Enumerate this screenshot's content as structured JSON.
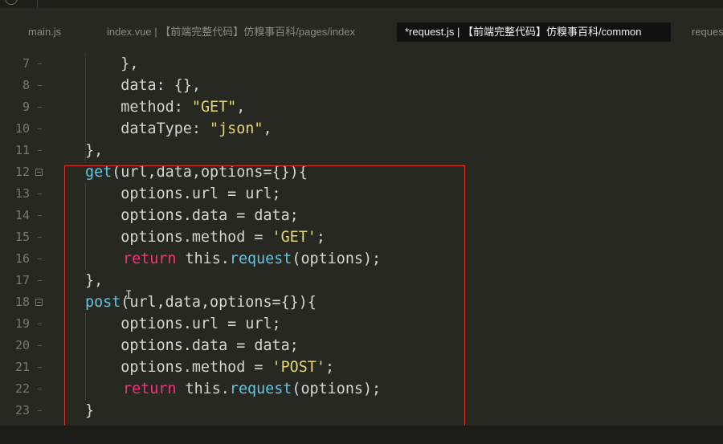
{
  "tabs": [
    {
      "label": "main.js",
      "active": false
    },
    {
      "label": "index.vue | 【前端完整代码】仿糗事百科/pages/index",
      "active": false
    },
    {
      "label": "*request.js | 【前端完整代码】仿糗事百科/common",
      "active": true
    },
    {
      "label": "reques",
      "active": false
    }
  ],
  "editor": {
    "lines": [
      {
        "num": "7",
        "fold": false
      },
      {
        "num": "8",
        "fold": false
      },
      {
        "num": "9",
        "fold": false
      },
      {
        "num": "10",
        "fold": false
      },
      {
        "num": "11",
        "fold": false
      },
      {
        "num": "12",
        "fold": true
      },
      {
        "num": "13",
        "fold": false
      },
      {
        "num": "14",
        "fold": false
      },
      {
        "num": "15",
        "fold": false
      },
      {
        "num": "16",
        "fold": false
      },
      {
        "num": "17",
        "fold": false
      },
      {
        "num": "18",
        "fold": true
      },
      {
        "num": "19",
        "fold": false
      },
      {
        "num": "20",
        "fold": false
      },
      {
        "num": "21",
        "fold": false
      },
      {
        "num": "22",
        "fold": false
      },
      {
        "num": "23",
        "fold": false
      }
    ],
    "code": {
      "l7": {
        "a": "    },"
      },
      "l8": {
        "a": "    data: {},"
      },
      "l9": {
        "a": "    method: ",
        "b": "\"GET\"",
        "c": ","
      },
      "l10": {
        "a": "    dataType: ",
        "b": "\"json\"",
        "c": ","
      },
      "l11": {
        "a": "},"
      },
      "l12": {
        "a": "get",
        "b": "(url,data,options={}){"
      },
      "l13": {
        "a": "    options.url = url;"
      },
      "l14": {
        "a": "    options.data = data;"
      },
      "l15": {
        "a": "    options.method = ",
        "b": "'GET'",
        "c": ";"
      },
      "l16": {
        "a": "return",
        "b": " this.",
        "c": "request",
        "d": "(options);"
      },
      "l17": {
        "a": "},"
      },
      "l18": {
        "a": "post",
        "b": "(url,data,options={}){"
      },
      "l19": {
        "a": "    options.url = url;"
      },
      "l20": {
        "a": "    options.data = data;"
      },
      "l21": {
        "a": "    options.method = ",
        "b": "'POST'",
        "c": ";"
      },
      "l22": {
        "a": "return",
        "b": " this.",
        "c": "request",
        "d": "(options);"
      },
      "l23": {
        "a": "}"
      }
    }
  },
  "cursor": "I",
  "colors": {
    "background": "#272822",
    "function": "#66c4df",
    "string": "#e4d77a",
    "keyword": "#f2347a",
    "highlight": "#e0302a"
  }
}
